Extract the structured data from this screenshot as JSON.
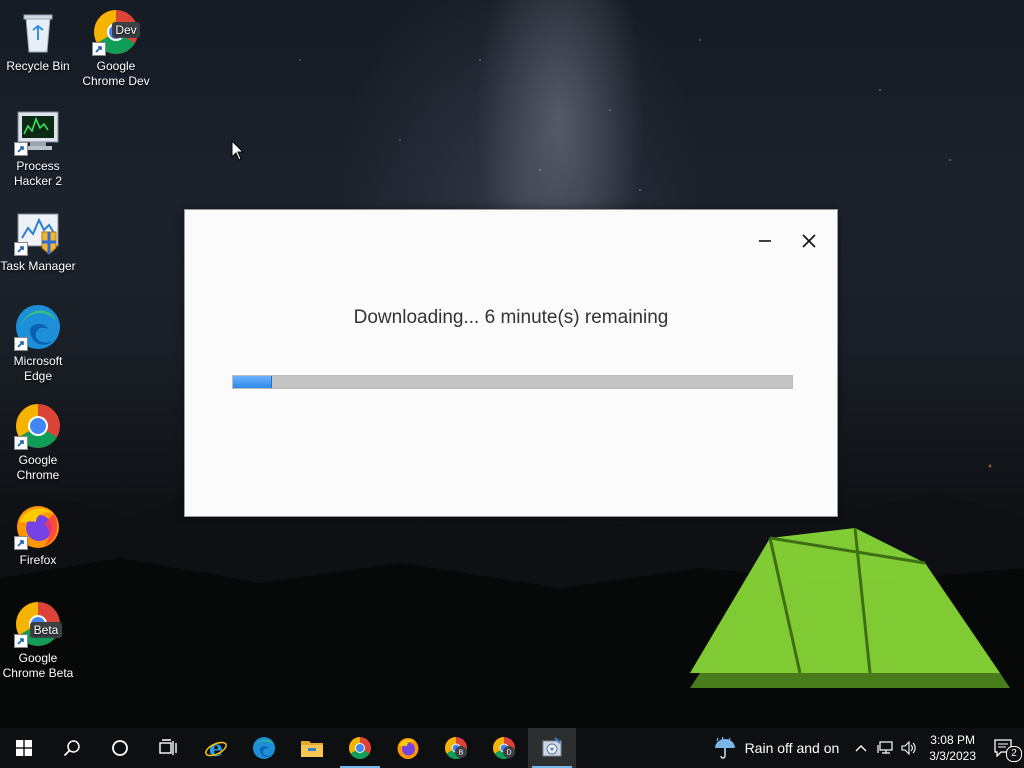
{
  "desktop": {
    "icons": [
      {
        "label_line1": "Recycle Bin",
        "label_line2": "",
        "icon": "recycle-bin-icon"
      },
      {
        "label_line1": "Google",
        "label_line2": "Chrome Dev",
        "icon": "chrome-dev-icon",
        "badge": "Dev"
      },
      {
        "label_line1": "Process",
        "label_line2": "Hacker 2",
        "icon": "process-hacker-icon"
      },
      {
        "label_line1": "Task Manager",
        "label_line2": "",
        "icon": "task-manager-icon"
      },
      {
        "label_line1": "Microsoft",
        "label_line2": "Edge",
        "icon": "edge-icon"
      },
      {
        "label_line1": "Google",
        "label_line2": "Chrome",
        "icon": "chrome-icon"
      },
      {
        "label_line1": "Firefox",
        "label_line2": "",
        "icon": "firefox-icon"
      },
      {
        "label_line1": "Google",
        "label_line2": "Chrome Beta",
        "icon": "chrome-beta-icon",
        "badge": "Beta"
      }
    ]
  },
  "dialog": {
    "status": "Downloading... 6 minute(s) remaining",
    "progress_fraction": 0.07,
    "minimize_icon": "minimize-icon",
    "close_icon": "close-icon"
  },
  "taskbar": {
    "items": [
      {
        "icon": "start-icon"
      },
      {
        "icon": "search-icon"
      },
      {
        "icon": "cortana-icon"
      },
      {
        "icon": "task-view-icon"
      },
      {
        "icon": "internet-explorer-icon"
      },
      {
        "icon": "edge-icon"
      },
      {
        "icon": "file-explorer-icon"
      },
      {
        "icon": "chrome-icon"
      },
      {
        "icon": "firefox-icon"
      },
      {
        "icon": "chrome-beta-icon",
        "badge": "B"
      },
      {
        "icon": "chrome-dev-icon",
        "badge": "D"
      },
      {
        "icon": "installer-icon"
      }
    ],
    "weather": {
      "text": "Rain off and on",
      "icon": "rain-umbrella-icon"
    },
    "clock": {
      "time": "3:08 PM",
      "date": "3/3/2023"
    },
    "notifications": {
      "count": "2"
    }
  },
  "colors": {
    "accent": "#2d8ae8",
    "taskbar_indicator": "#76b9ed",
    "tent_green": "#8ee03a"
  }
}
